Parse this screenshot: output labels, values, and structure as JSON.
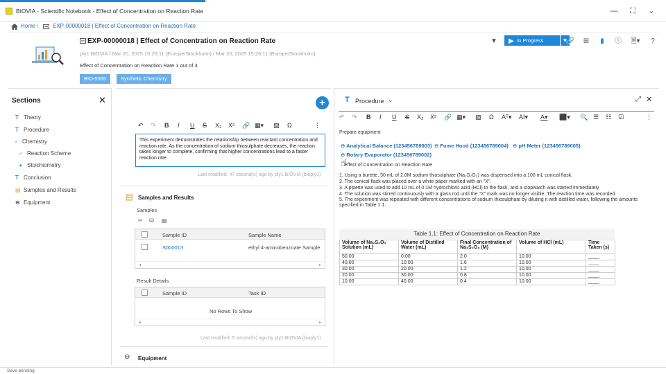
{
  "window": {
    "title": "BIOVIA - Scientific Notebook - Effect of Concentration on Reaction Rate",
    "minimize": "—",
    "expand": "⛶",
    "chevron": "⌄"
  },
  "breadcrumb": {
    "home": "Home",
    "separator": "\\",
    "experiment": "EXP-00000018 | Effect of Concentration on Reaction Rate"
  },
  "header": {
    "title": "EXP-00000018 | Effect of Concentration on Reaction Rate",
    "meta": "ply1 BIOVIA / Mar 20, 2025 15:26:11 (Europe/Stockholm) / Mar 20, 2025 15:26:11 (Europe/Stockholm)",
    "description": "Effect of Concentration on Reaction Rate 1 out of 3",
    "tags": [
      "BIO-5555",
      "Synthetic Chemistry"
    ],
    "status": "In Progress",
    "accent": "#1f87d8"
  },
  "sections": {
    "title": "Sections",
    "close": "✕",
    "items": [
      {
        "label": "Theory",
        "icon": "T"
      },
      {
        "label": "Procedure",
        "icon": "T"
      },
      {
        "label": "Chemistry",
        "icon": "♂"
      },
      {
        "label": "Reaction Scheme",
        "icon": "♂"
      },
      {
        "label": "Stoichiometry",
        "icon": "◕"
      },
      {
        "label": "Conclusion",
        "icon": "T"
      },
      {
        "label": "Samples and Results",
        "icon": "▤"
      },
      {
        "label": "Equipment",
        "icon": "⊖"
      }
    ]
  },
  "theory": {
    "text": "This experiment demonstrates the relationship between reactant concentration and reaction rate. As the concentration of sodium thiosulphate decreases, the reaction takes longer to complete, confirming that higher concentrations lead to a faster reaction rate.",
    "last_modified": "Last modified: 47 second(s) ago by ply1 BIOVIA (bioply1)"
  },
  "samples_results": {
    "title": "Samples and Results",
    "samples_label": "Samples",
    "samples_columns": [
      "Sample ID",
      "Sample Name"
    ],
    "samples_rows": [
      {
        "id": "S000013",
        "name": "ethyl 4-aminobenzoate Sample"
      }
    ],
    "result_label": "Result Details",
    "result_columns": [
      "Sample ID",
      "Task ID"
    ],
    "no_rows": "No Rows To Show",
    "last_modified": "Last modified: 5 second(s) ago by ply1 BIOVIA (bioply1)"
  },
  "equipment_section": {
    "title": "Equipment"
  },
  "procedure": {
    "title": "Procedure",
    "prepare": "Prepare equipment",
    "equipment": [
      "Analytical Balance (123456789003)",
      "Fume Hood (123456789004)",
      "pH Meter (123456789005)",
      "Rotary Evaporator (123456789002)"
    ],
    "subtitle": "Effect of Concentration on Reaction Rate",
    "steps": [
      "1. Using a burette, 50 mL of 2.0M sodium thiosulphate (Na₂S₂O₃) was dispensed into a 100 mL conical flask.",
      "2. The conical flask was placed over a white paper marked with an \"X\".",
      "3. A pipette was used to add 10 mL of 0.1M hydrochloric acid (HCl) to the flask, and a stopwatch was started immediately.",
      "4. The solution was stirred continuously with a glass rod until the \"X\" mark was no longer visible. The reaction time was recorded.",
      "5. The experiment was repeated with different concentrations of sodium thiosulphate by diluting it with distilled water, following the amounts specified in Table 1.1."
    ],
    "table_caption": "Table 1.1: Effect of Concentration on Reaction Rate",
    "table_headers": [
      "Volume of Na₂S₂O₃ Solution (mL)",
      "Volume of Distilled Water (mL)",
      "Final Concentration of Na₂S₂O₃ (M)",
      "Volume of HCl (mL)",
      "Time Taken (s)"
    ],
    "table_rows": [
      [
        "50.00",
        "0.00",
        "2.0",
        "10.00",
        "____"
      ],
      [
        "40.00",
        "10.00",
        "1.6",
        "10.00",
        "____"
      ],
      [
        "30.00",
        "20.00",
        "1.2",
        "10.00",
        "____"
      ],
      [
        "20.00",
        "30.00",
        "0.8",
        "10.00",
        "____"
      ],
      [
        "10.00",
        "40.00",
        "0.4",
        "10.00",
        "____"
      ]
    ]
  },
  "status_bar": {
    "text": "Save pending"
  }
}
